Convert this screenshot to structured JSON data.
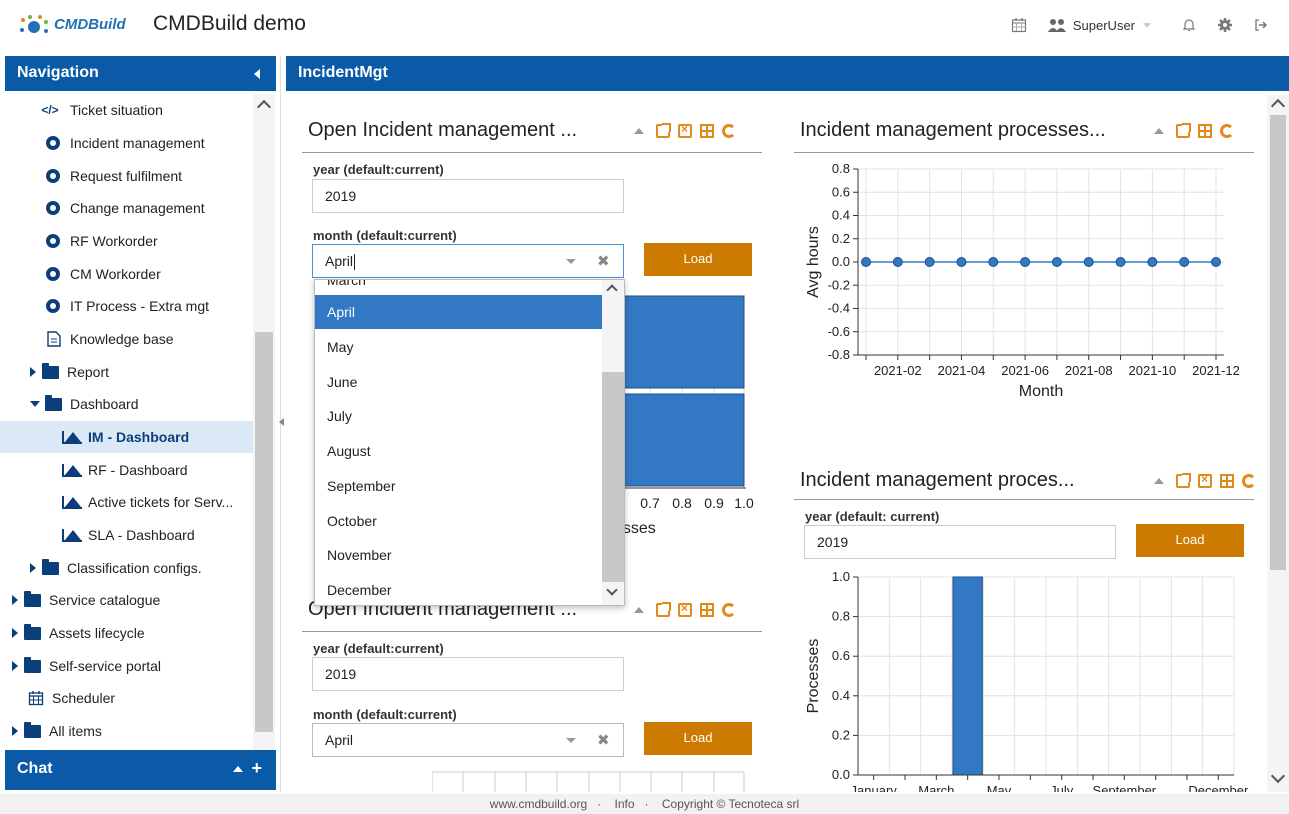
{
  "header": {
    "logo_text": "CMDBuild",
    "app_title": "CMDBuild demo",
    "user_name": "SuperUser"
  },
  "nav": {
    "title": "Navigation",
    "items": [
      {
        "label": "Ticket situation",
        "icon": "code-icon"
      },
      {
        "label": "Incident management",
        "icon": "gear-icon"
      },
      {
        "label": "Request fulfilment",
        "icon": "gear-icon"
      },
      {
        "label": "Change management",
        "icon": "gear-icon"
      },
      {
        "label": "RF Workorder",
        "icon": "gear-icon"
      },
      {
        "label": "CM Workorder",
        "icon": "gear-icon"
      },
      {
        "label": "IT Process - Extra mgt",
        "icon": "gear-icon"
      },
      {
        "label": "Knowledge base",
        "icon": "document-icon"
      },
      {
        "label": "Report",
        "icon": "folder-icon"
      },
      {
        "label": "Dashboard",
        "icon": "folder-icon"
      },
      {
        "label": "IM - Dashboard",
        "icon": "chart-icon"
      },
      {
        "label": "RF - Dashboard",
        "icon": "chart-icon"
      },
      {
        "label": "Active tickets for Serv...",
        "icon": "chart-icon"
      },
      {
        "label": "SLA - Dashboard",
        "icon": "chart-icon"
      },
      {
        "label": "Classification configs.",
        "icon": "folder-icon"
      },
      {
        "label": "Service catalogue",
        "icon": "folder-icon"
      },
      {
        "label": "Assets lifecycle",
        "icon": "folder-icon"
      },
      {
        "label": "Self-service portal",
        "icon": "folder-icon"
      },
      {
        "label": "Scheduler",
        "icon": "calendar-icon"
      },
      {
        "label": "All items",
        "icon": "folder-icon"
      }
    ],
    "chat_title": "Chat"
  },
  "main": {
    "title": "IncidentMgt",
    "panel1": {
      "title": "Open Incident management ...",
      "year_label": "year (default:current)",
      "year_value": "2019",
      "month_label": "month (default:current)",
      "month_value": "April",
      "load": "Load",
      "xaxis_partial": "cesses"
    },
    "panel2": {
      "title": "Incident management processes..."
    },
    "panel3": {
      "title": "Incident management proces...",
      "year_label": "year (default: current)",
      "year_value": "2019",
      "load": "Load"
    },
    "panel4": {
      "title": "Open Incident management ...",
      "year_label": "year (default:current)",
      "year_value": "2019",
      "month_label": "month (default:current)",
      "month_value": "April",
      "load": "Load"
    }
  },
  "dropdown": {
    "partial_top": "March",
    "options": [
      "April",
      "May",
      "June",
      "July",
      "August",
      "September",
      "October",
      "November",
      "December"
    ],
    "selected": "April"
  },
  "chart_data": [
    {
      "type": "line",
      "title": "",
      "xlabel": "Month",
      "ylabel": "Avg hours",
      "x": [
        "2021-01",
        "2021-02",
        "2021-03",
        "2021-04",
        "2021-05",
        "2021-06",
        "2021-07",
        "2021-08",
        "2021-09",
        "2021-10",
        "2021-11",
        "2021-12"
      ],
      "x_ticks": [
        "2021-02",
        "2021-04",
        "2021-06",
        "2021-08",
        "2021-10",
        "2021-12"
      ],
      "series": [
        {
          "values": [
            0,
            0,
            0,
            0,
            0,
            0,
            0,
            0,
            0,
            0,
            0,
            0
          ]
        }
      ],
      "ylim": [
        -0.8,
        0.8
      ],
      "y_ticks": [
        "0.8",
        "0.6",
        "0.4",
        "0.2",
        "0.0",
        "-0.2",
        "-0.4",
        "-0.6",
        "-0.8"
      ],
      "grid": true
    },
    {
      "type": "bar",
      "title": "",
      "xlabel": "",
      "ylabel": "Processes",
      "categories": [
        "January",
        "February",
        "March",
        "April",
        "May",
        "June",
        "July",
        "August",
        "September",
        "October",
        "November",
        "December"
      ],
      "x_ticks": [
        "January",
        "March",
        "May",
        "July",
        "September",
        "December"
      ],
      "values": [
        0,
        0,
        0,
        1,
        0,
        0,
        0,
        0,
        0,
        0,
        0,
        0
      ],
      "ylim": [
        0,
        1.0
      ],
      "y_ticks": [
        "1.0",
        "0.8",
        "0.6",
        "0.4",
        "0.2",
        "0.0"
      ],
      "grid": true
    },
    {
      "type": "bar",
      "title": "",
      "xlabel": "",
      "orientation": "horizontal",
      "x_ticks_visible": [
        "5",
        "0.7",
        "0.8",
        "0.9",
        "1.0"
      ],
      "grid": true
    }
  ],
  "footer": {
    "site": "www.cmdbuild.org",
    "info": "Info",
    "copyright": "Copyright © Tecnoteca srl"
  }
}
